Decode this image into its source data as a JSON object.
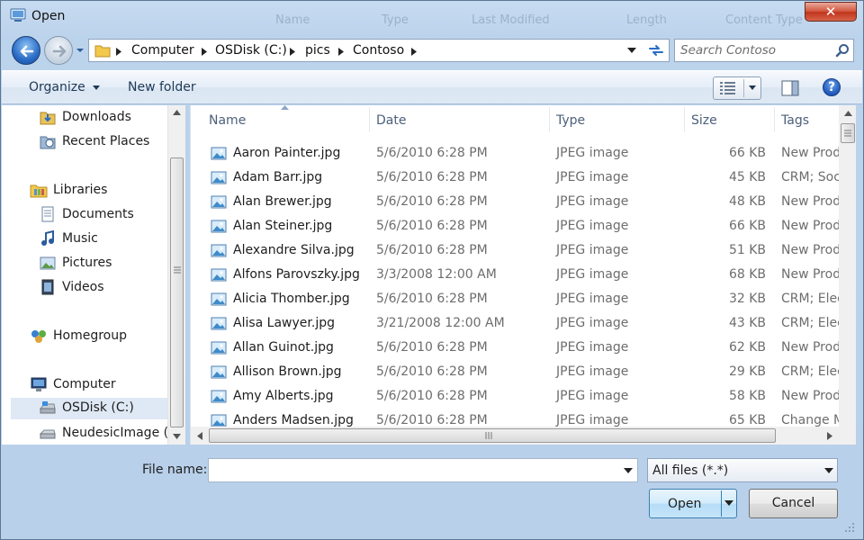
{
  "window": {
    "title": "Open",
    "close_glyph": "✕",
    "ghost_headers": [
      "Name",
      "Type",
      "Last Modified",
      "Length",
      "Content Type"
    ]
  },
  "address_bar": {
    "crumbs": [
      "Computer",
      "OSDisk (C:)",
      "pics",
      "Contoso"
    ]
  },
  "search": {
    "placeholder": "Search Contoso"
  },
  "toolbar": {
    "organize_label": "Organize",
    "new_folder_label": "New folder",
    "help_glyph": "?"
  },
  "nav_pane": {
    "items": [
      {
        "label": "Downloads",
        "icon": "downloads-folder-icon"
      },
      {
        "label": "Recent Places",
        "icon": "recent-places-icon"
      },
      {
        "label": "Libraries",
        "icon": "libraries-icon"
      },
      {
        "label": "Documents",
        "icon": "documents-icon"
      },
      {
        "label": "Music",
        "icon": "music-icon"
      },
      {
        "label": "Pictures",
        "icon": "pictures-icon"
      },
      {
        "label": "Videos",
        "icon": "videos-icon"
      },
      {
        "label": "Homegroup",
        "icon": "homegroup-icon"
      },
      {
        "label": "Computer",
        "icon": "computer-icon"
      },
      {
        "label": "OSDisk (C:)",
        "icon": "disk-icon",
        "selected": true
      },
      {
        "label": "NeudesicImage (I",
        "icon": "drive-icon"
      }
    ]
  },
  "file_list": {
    "columns": [
      "Name",
      "Date",
      "Type",
      "Size",
      "Tags"
    ],
    "rows": [
      {
        "name": "Aaron Painter.jpg",
        "date": "5/6/2010 6:28 PM",
        "type": "JPEG image",
        "size": "66 KB",
        "tags": "New Prod"
      },
      {
        "name": "Adam Barr.jpg",
        "date": "5/6/2010 6:28 PM",
        "type": "JPEG image",
        "size": "45 KB",
        "tags": "CRM; Soci"
      },
      {
        "name": "Alan Brewer.jpg",
        "date": "5/6/2010 6:28 PM",
        "type": "JPEG image",
        "size": "48 KB",
        "tags": "New Prod"
      },
      {
        "name": "Alan Steiner.jpg",
        "date": "5/6/2010 6:28 PM",
        "type": "JPEG image",
        "size": "66 KB",
        "tags": "New Prod"
      },
      {
        "name": "Alexandre Silva.jpg",
        "date": "5/6/2010 6:28 PM",
        "type": "JPEG image",
        "size": "51 KB",
        "tags": "New Prod"
      },
      {
        "name": "Alfons Parovszky.jpg",
        "date": "3/3/2008 12:00 AM",
        "type": "JPEG image",
        "size": "68 KB",
        "tags": "New Prod"
      },
      {
        "name": "Alicia Thomber.jpg",
        "date": "5/6/2010 6:28 PM",
        "type": "JPEG image",
        "size": "32 KB",
        "tags": "CRM; Elec"
      },
      {
        "name": "Alisa Lawyer.jpg",
        "date": "3/21/2008 12:00 AM",
        "type": "JPEG image",
        "size": "43 KB",
        "tags": "CRM; Elec"
      },
      {
        "name": "Allan Guinot.jpg",
        "date": "5/6/2010 6:28 PM",
        "type": "JPEG image",
        "size": "62 KB",
        "tags": "New Prod"
      },
      {
        "name": "Allison Brown.jpg",
        "date": "5/6/2010 6:28 PM",
        "type": "JPEG image",
        "size": "29 KB",
        "tags": "CRM; Elec"
      },
      {
        "name": "Amy Alberts.jpg",
        "date": "5/6/2010 6:28 PM",
        "type": "JPEG image",
        "size": "58 KB",
        "tags": "New Prod"
      },
      {
        "name": "Anders Madsen.jpg",
        "date": "5/6/2010 6:28 PM",
        "type": "JPEG image",
        "size": "65 KB",
        "tags": "Change M"
      }
    ]
  },
  "footer": {
    "file_name_label": "File name:",
    "file_name_value": "",
    "file_type_selected": "All files (*.*)",
    "open_label": "Open",
    "cancel_label": "Cancel"
  }
}
